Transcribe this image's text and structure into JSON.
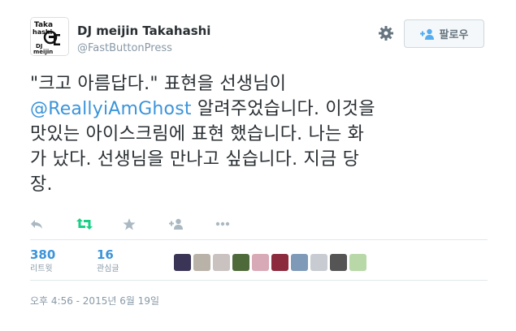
{
  "author": {
    "fullname": "DJ meijin Takahashi",
    "username": "@FastButtonPress",
    "avatar_lines": [
      "Taka",
      "hashi",
      "DJ",
      "meijin"
    ]
  },
  "follow_button": {
    "label": "팔로우"
  },
  "tweet": {
    "text_line1": "\"크고 아름답다.\" 표현을 선생님이",
    "mention": "@ReallyiAmGhost",
    "text_line2_rest": " 알려주었습니다. 이것을",
    "text_line3": "맛있는 아이스크림에 표현 했습니다. 나는 화",
    "text_line4": "가 났다. 선생님을 만나고 싶습니다. 지금 당",
    "text_line5": "장."
  },
  "actions": [
    {
      "name": "reply",
      "icon": "reply-icon"
    },
    {
      "name": "retweet",
      "icon": "retweet-icon"
    },
    {
      "name": "favorite",
      "icon": "star-icon"
    },
    {
      "name": "follow-user",
      "icon": "person-add-icon"
    },
    {
      "name": "more",
      "icon": "ellipsis-icon"
    }
  ],
  "stats": {
    "retweets": {
      "count": "380",
      "label": "리트윗"
    },
    "favorites": {
      "count": "16",
      "label": "관심글"
    }
  },
  "likers": [
    {
      "color": "#3a3556"
    },
    {
      "color": "#b9b2a8"
    },
    {
      "color": "#c9c2c0"
    },
    {
      "color": "#4f6a3a"
    },
    {
      "color": "#d8a9b6"
    },
    {
      "color": "#8c2a3e"
    },
    {
      "color": "#7e9ab8"
    },
    {
      "color": "#c8ccd2"
    },
    {
      "color": "#555555"
    },
    {
      "color": "#b8d8a8"
    }
  ],
  "timestamp": "오후 4:56 - 2015년 6월 19일",
  "colors": {
    "link": "#3b94d9",
    "retweet_active": "#19cf86",
    "muted": "#8899a6"
  }
}
